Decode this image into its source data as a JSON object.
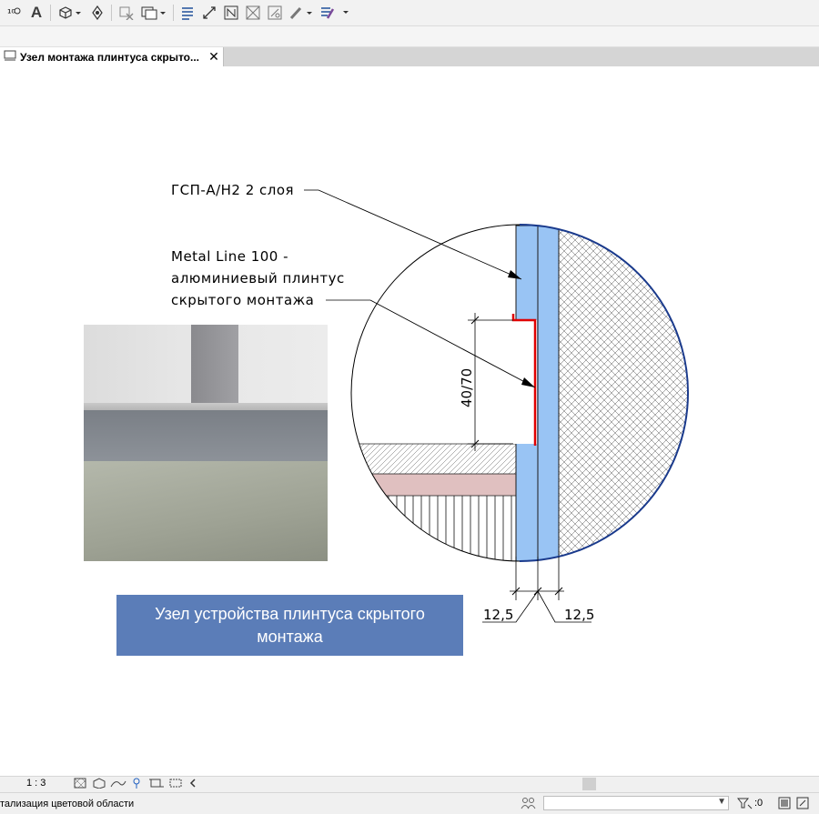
{
  "toolbar": {
    "icons": [
      "annotation-icon",
      "text-icon",
      "3d-view-icon",
      "measure-icon",
      "hide-icon",
      "switch-windows-icon",
      "properties-icon",
      "dimension-icon",
      "tag-icon",
      "align-icon",
      "thin-lines-icon",
      "paint-icon",
      "settings-icon"
    ],
    "text_tool": "A"
  },
  "tab": {
    "label": "Узел монтажа плинтуса скрыто...",
    "close": "✕"
  },
  "drawing": {
    "label_gsp": "ГСП-А/Н2 2 слоя",
    "label_metal_line1": "Metal Line 100 -",
    "label_metal_line2": "алюминиевый плинтус",
    "label_metal_line3": "скрытого монтажа",
    "dim_height": "40/70",
    "dim_left": "12,5",
    "dim_right": "12,5",
    "colors": {
      "gypsum_board": "#99c4f4",
      "plinth_profile": "#e00000",
      "concrete_outline": "#1a3a8c",
      "floor_finish": "#e0c0c0"
    }
  },
  "caption": {
    "text": "Узел устройства плинтуса скрытого монтажа"
  },
  "statusbar": {
    "scale": "1 : 3",
    "message": "тализация цветовой области",
    "selection_count": ":0"
  }
}
